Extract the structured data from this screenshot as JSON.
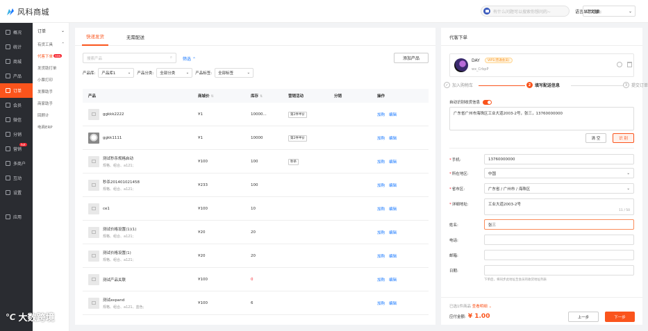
{
  "app": {
    "name": "风科商城",
    "brand_color": "#fa541c"
  },
  "header": {
    "search_placeholder": "有什么问题可以搜索你想问的~",
    "lang_label": "语言显示切换:",
    "lang_value": "中文版"
  },
  "leftnav": [
    {
      "label": "概况",
      "icon": "home-icon"
    },
    {
      "label": "统计",
      "icon": "chart-icon"
    },
    {
      "label": "商城",
      "icon": "shop-icon"
    },
    {
      "label": "产品",
      "icon": "box-icon"
    },
    {
      "label": "订单",
      "icon": "order-icon",
      "active": true
    },
    {
      "label": "会员",
      "icon": "user-icon"
    },
    {
      "label": "微信",
      "icon": "wechat-icon"
    },
    {
      "label": "分销",
      "icon": "share-icon"
    },
    {
      "label": "营销",
      "icon": "flag-icon",
      "badge": "hot"
    },
    {
      "label": "多商户",
      "icon": "store-icon"
    },
    {
      "label": "互动",
      "icon": "chat-icon"
    },
    {
      "label": "设置",
      "icon": "gear-icon"
    },
    {
      "label": "应用",
      "icon": "grid-icon"
    }
  ],
  "subnav": {
    "head": "订单",
    "group": "有货工具",
    "items": [
      {
        "label": "代客下单",
        "badge": "new",
        "active": true
      },
      {
        "label": "发货助打单"
      },
      {
        "label": "小票打印"
      },
      {
        "label": "发票助手"
      },
      {
        "label": "商家助手"
      },
      {
        "label": "回顾计"
      },
      {
        "label": "电商ERP"
      }
    ]
  },
  "main": {
    "tabs": [
      "快递发货",
      "无需配送"
    ],
    "search_placeholder": "搜索产品",
    "filter_link": "筛选",
    "add_button": "添加产品",
    "filters": [
      {
        "label": "产品库:",
        "value": "产品库1"
      },
      {
        "label": "产品分类:",
        "value": "全部分类"
      },
      {
        "label": "产品标签:",
        "value": "全部标签"
      }
    ],
    "columns": [
      "产品",
      "商城价",
      "库存",
      "营销活动",
      "分销",
      "操作"
    ],
    "actions": {
      "add": "加购",
      "edit": "编辑"
    },
    "rows": [
      {
        "name": "ggkkk2222",
        "spec": "",
        "price": "¥1",
        "stock": "10000...",
        "promo": "第2件半价",
        "thumb": "placeholder"
      },
      {
        "name": "ggkk1111",
        "spec": "",
        "price": "¥1",
        "stock": "10000",
        "promo": "第2件半价",
        "thumb": "cat"
      },
      {
        "name": "测试秒杀规格启动",
        "spec": "规格、组合、a121;",
        "price": "¥100",
        "stock": "100",
        "promo": "秒杀",
        "thumb": "placeholder"
      },
      {
        "name": "秒杀201401021458",
        "spec": "规格、组合、a121;",
        "price": "¥233",
        "stock": "100",
        "promo": "",
        "thumb": "placeholder"
      },
      {
        "name": "ce1",
        "spec": "",
        "price": "¥100",
        "stock": "10",
        "promo": "",
        "thumb": "placeholder"
      },
      {
        "name": "测试价格设置(1)(1)",
        "spec": "规格、组合、a121;",
        "price": "¥20",
        "stock": "20",
        "promo": "",
        "thumb": "placeholder"
      },
      {
        "name": "测试价格设置(1)",
        "spec": "规格、组合、a121;",
        "price": "¥20",
        "stock": "20",
        "promo": "",
        "thumb": "placeholder"
      },
      {
        "name": "测试产品关联",
        "spec": "",
        "price": "¥100",
        "stock": "0",
        "promo": "",
        "thumb": "placeholder",
        "stock_red": true
      },
      {
        "name": "测试expand",
        "spec": "规格、组合、a121、蓝色;",
        "price": "¥100",
        "stock": "6",
        "promo": "",
        "thumb": "placeholder"
      }
    ]
  },
  "order": {
    "title": "代客下单",
    "member": {
      "name": "DAY",
      "level": "VIP1(普通会员)",
      "id": "wx_CrbpP"
    },
    "steps": [
      "加入购物车",
      "填写配送信息",
      "提交订单"
    ],
    "auto_label": "自动识别收货信息",
    "address_text": "广东省广州市海珠区工业大道2003-2号，张三，13760000000",
    "clear_btn": "清 空",
    "parse_btn": "识 别",
    "fields": [
      {
        "label": "手机:",
        "value": "13760000000",
        "required": true
      },
      {
        "label": "所在地区:",
        "value": "中国",
        "required": true,
        "select": true
      },
      {
        "label": "省市区:",
        "value": "广东省 / 广州市 / 海珠区",
        "required": true,
        "select": true
      },
      {
        "label": "详细地址:",
        "value": "工业大道2003-2号",
        "required": true,
        "count": "11 / 50"
      },
      {
        "label": "姓名:",
        "value": "张三"
      },
      {
        "label": "电话:",
        "value": ""
      },
      {
        "label": "邮箱:",
        "value": ""
      },
      {
        "label": "日期:",
        "value": ""
      }
    ],
    "hint": "下单后，将同步此地址至会员的收货地址列表",
    "selected": "已选1件商品",
    "expand": "查看明细",
    "total_label": "应付金额:",
    "total_amount": "¥ 1.00",
    "prev": "上一步",
    "next": "下一步"
  },
  "watermark": "大数跨境"
}
